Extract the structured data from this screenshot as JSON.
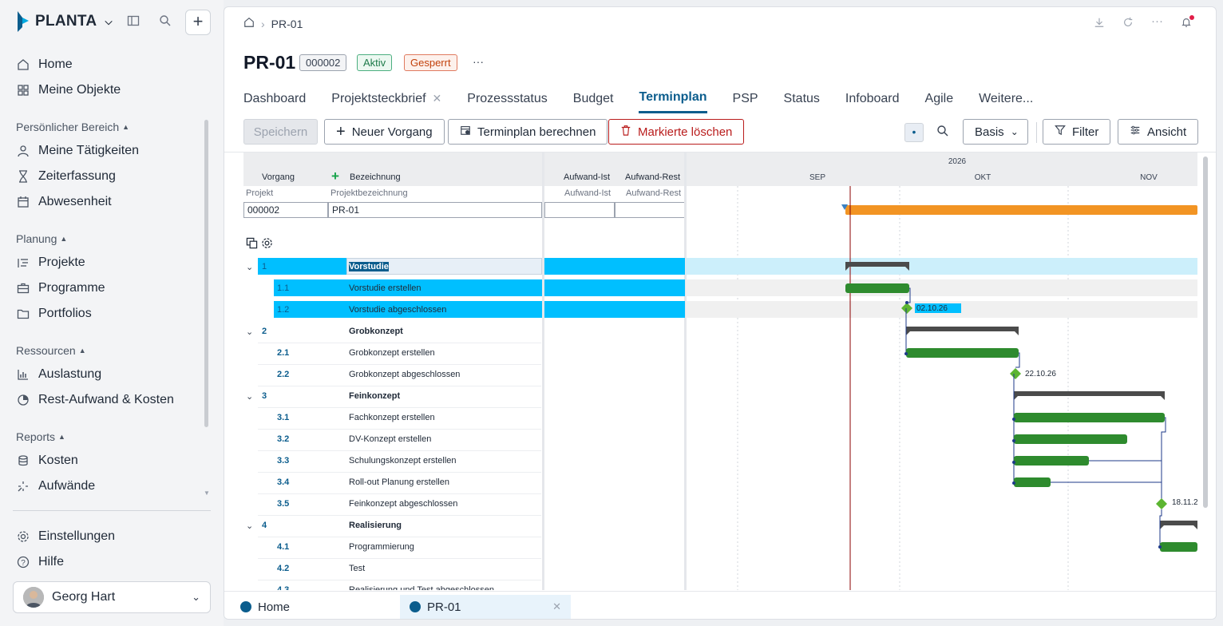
{
  "brand": {
    "name": "PLANTA"
  },
  "sidebar": {
    "top_items": [
      {
        "label": "Home",
        "icon": "home-icon"
      },
      {
        "label": "Meine Objekte",
        "icon": "grid-icon"
      }
    ],
    "sections": [
      {
        "title": "Persönlicher Bereich",
        "items": [
          {
            "label": "Meine Tätigkeiten",
            "icon": "user-icon"
          },
          {
            "label": "Zeiterfassung",
            "icon": "hourglass-icon"
          },
          {
            "label": "Abwesenheit",
            "icon": "calendar-icon"
          }
        ]
      },
      {
        "title": "Planung",
        "items": [
          {
            "label": "Projekte",
            "icon": "list-icon"
          },
          {
            "label": "Programme",
            "icon": "briefcase-icon"
          },
          {
            "label": "Portfolios",
            "icon": "folder-icon"
          }
        ]
      },
      {
        "title": "Ressourcen",
        "items": [
          {
            "label": "Auslastung",
            "icon": "barchart-icon"
          },
          {
            "label": "Rest-Aufwand & Kosten",
            "icon": "piechart-icon"
          }
        ]
      },
      {
        "title": "Reports",
        "items": [
          {
            "label": "Kosten",
            "icon": "coins-icon"
          },
          {
            "label": "Aufwände",
            "icon": "sparkle-icon"
          }
        ]
      }
    ],
    "bottom_items": [
      {
        "label": "Einstellungen",
        "icon": "gear-icon"
      },
      {
        "label": "Hilfe",
        "icon": "help-icon"
      }
    ],
    "user": {
      "name": "Georg Hart"
    }
  },
  "breadcrumb": {
    "current": "PR-01"
  },
  "project": {
    "title": "PR-01",
    "number": "000002",
    "status_active": "Aktiv",
    "status_locked": "Gesperrt",
    "more": "···"
  },
  "tabs": [
    "Dashboard",
    "Projektsteckbrief",
    "Prozessstatus",
    "Budget",
    "Terminplan",
    "PSP",
    "Status",
    "Infoboard",
    "Agile",
    "Weitere..."
  ],
  "toolbar": {
    "save": "Speichern",
    "new_task": "Neuer Vorgang",
    "calc": "Terminplan berechnen",
    "delete": "Markierte löschen",
    "basis": "Basis",
    "filter": "Filter",
    "view": "Ansicht"
  },
  "grid": {
    "header": {
      "vorgang": "Vorgang",
      "bezeichnung": "Bezeichnung",
      "aufwand_ist": "Aufwand-Ist",
      "aufwand_rest": "Aufwand-Rest",
      "projekt": "Projekt",
      "projektbezeichnung": "Projektbezeichnung",
      "aufwand_ist2": "Aufwand-Ist",
      "aufwand_rest2": "Aufwand-Rest"
    },
    "project_row": {
      "projekt": "000002",
      "bezeichnung": "PR-01"
    },
    "rows": [
      {
        "num": "1",
        "name": "Vorstudie",
        "bold": true,
        "group": true
      },
      {
        "num": "1.1",
        "name": "Vorstudie erstellen",
        "bold": false,
        "group": false
      },
      {
        "num": "1.2",
        "name": "Vorstudie abgeschlossen",
        "bold": false,
        "group": false
      },
      {
        "num": "2",
        "name": "Grobkonzept",
        "bold": true,
        "group": true
      },
      {
        "num": "2.1",
        "name": "Grobkonzept erstellen",
        "bold": false,
        "group": false
      },
      {
        "num": "2.2",
        "name": "Grobkonzept abgeschlossen",
        "bold": false,
        "group": false
      },
      {
        "num": "3",
        "name": "Feinkonzept",
        "bold": true,
        "group": true
      },
      {
        "num": "3.1",
        "name": "Fachkonzept erstellen",
        "bold": false,
        "group": false
      },
      {
        "num": "3.2",
        "name": "DV-Konzept erstellen",
        "bold": false,
        "group": false
      },
      {
        "num": "3.3",
        "name": "Schulungskonzept erstellen",
        "bold": false,
        "group": false
      },
      {
        "num": "3.4",
        "name": "Roll-out Planung erstellen",
        "bold": false,
        "group": false
      },
      {
        "num": "3.5",
        "name": "Feinkonzept abgeschlossen",
        "bold": false,
        "group": false
      },
      {
        "num": "4",
        "name": "Realisierung",
        "bold": true,
        "group": true
      },
      {
        "num": "4.1",
        "name": "Programmierung",
        "bold": false,
        "group": false
      },
      {
        "num": "4.2",
        "name": "Test",
        "bold": false,
        "group": false
      },
      {
        "num": "4.3",
        "name": "Realisierung und Test abgeschlossen",
        "bold": false,
        "group": false
      }
    ]
  },
  "gantt": {
    "year": "2026",
    "months": [
      "SEP",
      "OKT",
      "NOV"
    ],
    "milestones": [
      "02.10.26",
      "22.10.26",
      "18.11.2"
    ],
    "colors": {
      "summary": "#4b4b4b",
      "task": "#2e8b2e",
      "project": "#f29423",
      "milestone": "#5cb531",
      "today": "#8b0000",
      "highlight": "#00bfff"
    }
  },
  "bottom_tabs": [
    {
      "label": "Home"
    },
    {
      "label": "PR-01"
    }
  ]
}
